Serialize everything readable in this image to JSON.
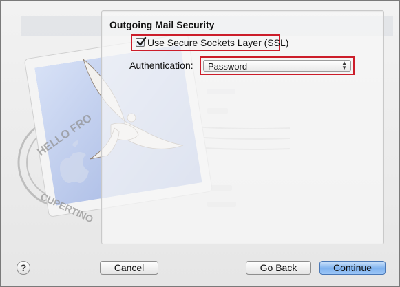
{
  "section": {
    "title": "Outgoing Mail Security"
  },
  "ssl": {
    "label": "Use Secure Sockets Layer (SSL)",
    "checked": true
  },
  "authentication": {
    "label": "Authentication:",
    "selected": "Password"
  },
  "buttons": {
    "help": "?",
    "cancel": "Cancel",
    "go_back": "Go Back",
    "continue": "Continue"
  },
  "stamp": {
    "postmark_top": "HELLO FRO",
    "postmark_bottom": "CUPERTINO"
  },
  "colors": {
    "highlight_border": "#cc1d2a",
    "primary_button": "#7fb2ee",
    "stamp_blue": "#b9c9ec"
  }
}
